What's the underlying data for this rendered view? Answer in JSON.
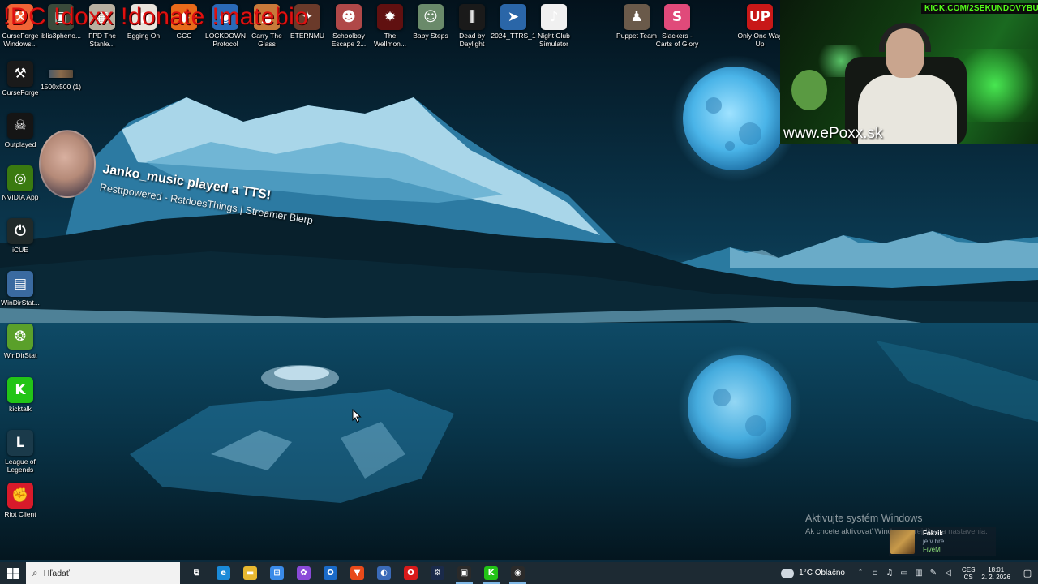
{
  "overlay": {
    "commands": "!DC !doxx  !donate !matebio",
    "tts_title": "Janko_music played a TTS!",
    "tts_subtitle": "Resttpowered - RstdoesThings | Streamer Blerp",
    "watermark": "www.ePoxx.sk",
    "kick_tag": "KICK.COM/2SEKUNDOVYBULO"
  },
  "desktop_icons_top": [
    {
      "label": "CurseForge Windows...",
      "icon": "curseforge-icon",
      "color": "#f16436",
      "glyph": "⚒"
    },
    {
      "label": "iblis3pheno...",
      "icon": "folder-icon",
      "color": "#3a4a3a",
      "glyph": "▣"
    },
    {
      "label": "FPD The Stanle...",
      "icon": "game-icon",
      "color": "#b8b0a0",
      "glyph": "▦"
    },
    {
      "label": "Egging On",
      "icon": "egg-icon",
      "color": "#e8e4dc",
      "glyph": "●"
    },
    {
      "label": "GCC",
      "icon": "gcc-icon",
      "color": "#e86a1a",
      "glyph": "◆"
    },
    {
      "label": "LOCKDOWN Protocol",
      "icon": "lockdown-icon",
      "color": "#2a6ab8",
      "glyph": "◉"
    },
    {
      "label": "Carry The Glass",
      "icon": "glass-icon",
      "color": "#c87a3a",
      "glyph": "▲"
    },
    {
      "label": "ETERNMU",
      "icon": "eternmu-icon",
      "color": "#6a3a2a",
      "glyph": "✦"
    },
    {
      "label": "Schoolboy Escape 2...",
      "icon": "schoolboy-icon",
      "color": "#b04848",
      "glyph": "☻"
    },
    {
      "label": "The Wellmon...",
      "icon": "wellmon-icon",
      "color": "#601010",
      "glyph": "✹"
    },
    {
      "label": "Baby Steps",
      "icon": "babysteps-icon",
      "color": "#6a8a6a",
      "glyph": "☺"
    },
    {
      "label": "Dead by Daylight",
      "icon": "dbd-icon",
      "color": "#1a1a1a",
      "glyph": "⫼"
    },
    {
      "label": "2024_TTRS_1",
      "icon": "ttrs-icon",
      "color": "#2a66a8",
      "glyph": "➤"
    },
    {
      "label": "Night Club Simulator",
      "icon": "nightclub-icon",
      "color": "#f0f0f0",
      "glyph": "♪"
    },
    {
      "label": "Puppet Team",
      "icon": "puppet-icon",
      "color": "#6a5a4a",
      "glyph": "♟"
    },
    {
      "label": "Slackers - Carts of Glory",
      "icon": "slackers-icon",
      "color": "#e04a7a",
      "glyph": "S"
    },
    {
      "label": "Only One Way Up",
      "icon": "onlyoneup-icon",
      "color": "#c81818",
      "glyph": "UP"
    }
  ],
  "desktop_icons_left": [
    {
      "label": "CurseForge",
      "icon": "curseforge-icon",
      "color": "#1a1a1a",
      "glyph": "⚒"
    },
    {
      "label": "Outplayed",
      "icon": "outplayed-icon",
      "color": "#151515",
      "glyph": "☠"
    },
    {
      "label": "NVIDIA App",
      "icon": "nvidia-icon",
      "color": "#3a7a10",
      "glyph": "◎"
    },
    {
      "label": "iCUE",
      "icon": "icue-icon",
      "color": "#202a2a",
      "glyph": "⏻"
    },
    {
      "label": "WinDirStat...",
      "icon": "windirstat-icon",
      "color": "#3a6aa0",
      "glyph": "▤"
    },
    {
      "label": "WinDirStat",
      "icon": "windirstat-icon",
      "color": "#5aa02a",
      "glyph": "❂"
    },
    {
      "label": "kicktalk",
      "icon": "kick-icon",
      "color": "#22c416",
      "glyph": "K"
    },
    {
      "label": "League of Legends",
      "icon": "lol-icon",
      "color": "#1a3a4a",
      "glyph": "L"
    },
    {
      "label": "Riot Client",
      "icon": "riot-icon",
      "color": "#d81a2a",
      "glyph": "✊"
    }
  ],
  "desktop_extra": {
    "label": "1500x500 (1)",
    "icon": "image-file-icon"
  },
  "activation": {
    "title": "Aktivujte systém Windows",
    "subtitle": "Ak chcete aktivovať Windows, prejdite na nastavenia."
  },
  "notification": {
    "name": "Fokzik",
    "state": "je v hre",
    "game": "FiveM"
  },
  "taskbar": {
    "search_placeholder": "Hľadať",
    "apps": [
      {
        "name": "task-view",
        "glyph": "⧉",
        "color": "transparent"
      },
      {
        "name": "edge",
        "glyph": "e",
        "color": "#1a8ad8"
      },
      {
        "name": "file-explorer",
        "glyph": "▬",
        "color": "#e8b830"
      },
      {
        "name": "ms-store",
        "glyph": "⊞",
        "color": "#3a8ae8"
      },
      {
        "name": "m365",
        "glyph": "✿",
        "color": "#8a4ad8"
      },
      {
        "name": "outlook",
        "glyph": "O",
        "color": "#1a6ac8"
      },
      {
        "name": "brave",
        "glyph": "▼",
        "color": "#e84a1a"
      },
      {
        "name": "app-blue",
        "glyph": "◐",
        "color": "#3a6ab8"
      },
      {
        "name": "opera",
        "glyph": "O",
        "color": "#d81a1a"
      },
      {
        "name": "steam",
        "glyph": "⚙",
        "color": "#1a2a4a"
      },
      {
        "name": "streamdeck",
        "glyph": "▣",
        "color": "#2a2a2a"
      },
      {
        "name": "kick",
        "glyph": "K",
        "color": "#22c416"
      },
      {
        "name": "obs",
        "glyph": "◉",
        "color": "#2a2a2a"
      }
    ],
    "weather": "1°C  Oblačno",
    "lang_top": "CES",
    "lang_bottom": "CS",
    "time": "18:01",
    "date": "2. 2. 2026"
  }
}
